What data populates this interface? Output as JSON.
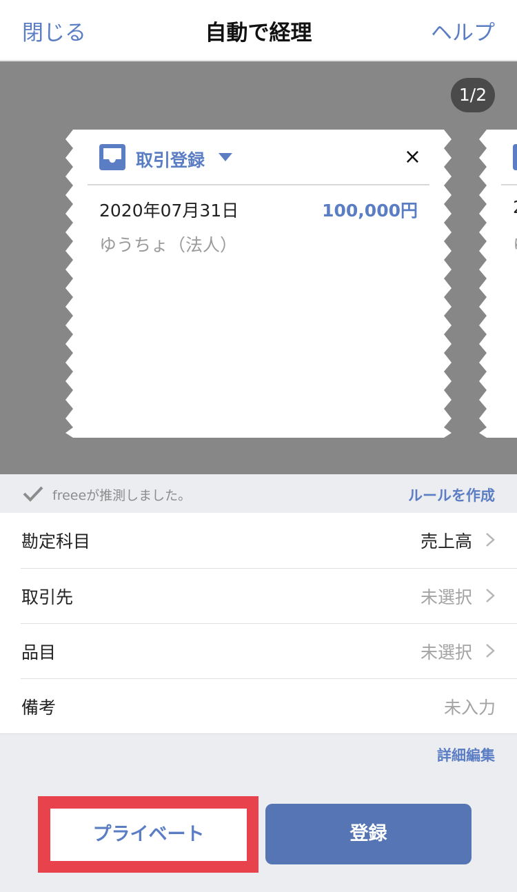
{
  "nav": {
    "close": "閉じる",
    "title": "自動で経理",
    "help": "ヘルプ"
  },
  "pager": {
    "label": "1/2",
    "current": 1,
    "total": 2
  },
  "card": {
    "icon": "inbox-tray-icon",
    "type_label": "取引登録",
    "close_symbol": "×",
    "date": "2020年07月31日",
    "amount": "100,000円",
    "account": "ゆうちょ（法人）"
  },
  "next_card": {
    "date_partial": "2",
    "account_partial": "ゆ"
  },
  "guess": {
    "text": "freeeが推測しました。",
    "rule_link": "ルールを作成",
    "icon": "check-icon"
  },
  "form": {
    "rows": [
      {
        "label": "勘定科目",
        "value": "売上高"
      },
      {
        "label": "取引先",
        "value": "未選択"
      },
      {
        "label": "品目",
        "value": "未選択"
      },
      {
        "label": "備考",
        "value": "未入力"
      }
    ]
  },
  "detail_link": "詳細編集",
  "buttons": {
    "private": "プライベート",
    "register": "登録"
  },
  "colors": {
    "accent": "#5a7dc4",
    "primary_button": "#5575b4",
    "highlight": "#e8434d",
    "stage": "#878787"
  }
}
